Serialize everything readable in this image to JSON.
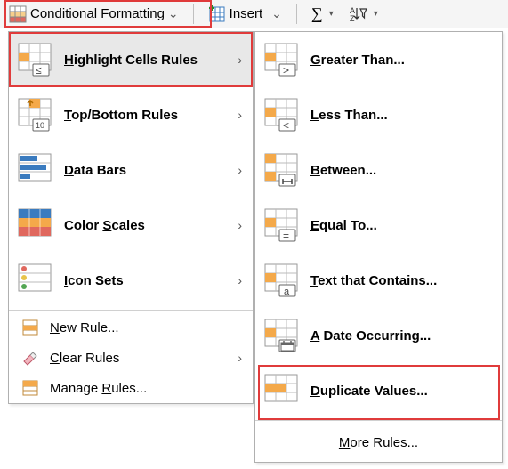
{
  "toolbar": {
    "cond_fmt": "Conditional Formatting",
    "insert": "Insert",
    "sum_dropdown": "",
    "filter_dropdown": ""
  },
  "menu1": {
    "highlight": "Highlight Cells Rules",
    "topbottom": "Top/Bottom Rules",
    "databars": "Data Bars",
    "colorscales": "Color Scales",
    "iconsets": "Icon Sets",
    "newrule": "New Rule...",
    "clearrules": "Clear Rules",
    "managerules": "Manage Rules..."
  },
  "menu2": {
    "greater": "Greater Than...",
    "less": "Less Than...",
    "between": "Between...",
    "equal": "Equal To...",
    "textcontains": "Text that Contains...",
    "dateoccur": "A Date Occurring...",
    "duplicate": "Duplicate Values...",
    "more": "More Rules..."
  }
}
